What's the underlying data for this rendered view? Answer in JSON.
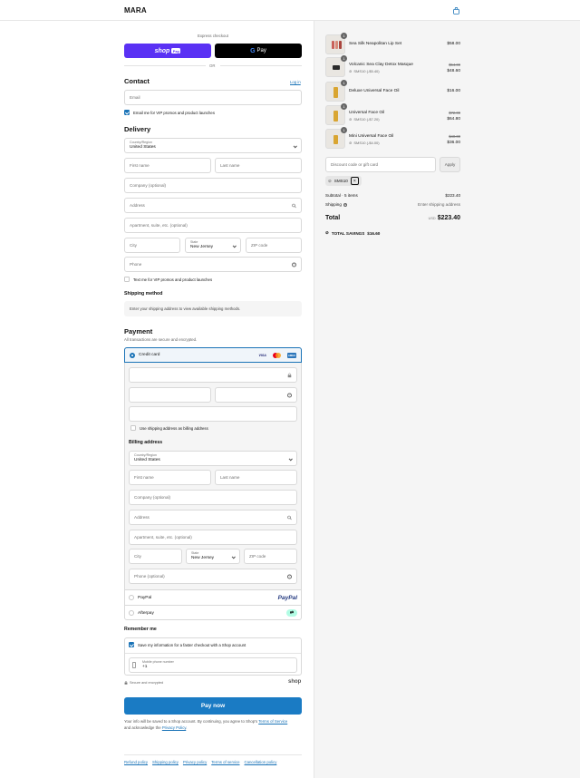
{
  "header": {
    "brand": "MARA"
  },
  "express": {
    "title": "Express checkout",
    "shop_pay": "shop",
    "shop_pay_badge": "Pay",
    "gpay": "Pay",
    "or": "OR"
  },
  "contact": {
    "title": "Contact",
    "login": "Log in",
    "email_placeholder": "Email",
    "vip_email": "Email me for VIP promos and product launches"
  },
  "delivery": {
    "title": "Delivery",
    "country_label": "Country/Region",
    "country_value": "United States",
    "first_name": "First name",
    "last_name": "Last name",
    "company": "Company (optional)",
    "address": "Address",
    "apartment": "Apartment, suite, etc. (optional)",
    "city": "City",
    "state_label": "State",
    "state_value": "New Jersey",
    "zip": "ZIP code",
    "phone": "Phone",
    "vip_text": "Text me for VIP promos and product launches"
  },
  "shipping_method": {
    "title": "Shipping method",
    "message": "Enter your shipping address to view available shipping methods."
  },
  "payment": {
    "title": "Payment",
    "subtitle": "All transactions are secure and encrypted.",
    "credit_card": "Credit card",
    "visa": "VISA",
    "amex": "AMEX",
    "use_shipping": "Use shipping address as billing address",
    "billing_title": "Billing address",
    "billing_country_label": "Country/Region",
    "billing_country_value": "United States",
    "billing_first": "First name",
    "billing_last": "Last name",
    "billing_company": "Company (optional)",
    "billing_address": "Address",
    "billing_apartment": "Apartment, suite, etc. (optional)",
    "billing_city": "City",
    "billing_state_label": "State",
    "billing_state_value": "New Jersey",
    "billing_zip": "ZIP code",
    "billing_phone": "Phone (optional)",
    "paypal": "PayPal",
    "paypal_logo": "PayPal",
    "afterpay": "Afterpay"
  },
  "remember": {
    "title": "Remember me",
    "save_info": "Save my information for a faster checkout with a Shop account",
    "mobile_label": "Mobile phone number",
    "mobile_value": "+1",
    "secure": "Secure and encrypted",
    "shop_logo": "shop"
  },
  "pay_now": "Pay now",
  "consent": {
    "text1": "Your info will be saved to a Shop account. By continuing, you agree to Shop's ",
    "tos": "Terms of Service",
    "text2": "and acknowledge the ",
    "privacy": "Privacy Policy",
    "end": "."
  },
  "footer_links": [
    "Refund policy",
    "Shipping policy",
    "Privacy policy",
    "Terms of service",
    "Cancellation policy"
  ],
  "cart": {
    "items": [
      {
        "qty": "1",
        "name": "Sea Silk Neapolitan Lip Set",
        "discount": "",
        "original": "",
        "price": "$58.00"
      },
      {
        "qty": "1",
        "name": "Volcanic Sea Clay Detox Masque",
        "discount": "SMS10 (-$5.40)",
        "original": "$54.00",
        "price": "$48.60"
      },
      {
        "qty": "1",
        "name": "Deluxe Universal Face Oil",
        "discount": "",
        "original": "",
        "price": "$16.00"
      },
      {
        "qty": "1",
        "name": "Universal Face Oil",
        "discount": "SMS10 (-$7.20)",
        "original": "$72.00",
        "price": "$64.80"
      },
      {
        "qty": "1",
        "name": "Mini Universal Face Oil",
        "discount": "SMS10 (-$4.00)",
        "original": "$40.00",
        "price": "$36.00"
      }
    ],
    "discount_placeholder": "Discount code or gift card",
    "apply": "Apply",
    "applied_code": "SMS10",
    "subtotal_label": "Subtotal · 5 items",
    "subtotal_value": "$223.40",
    "shipping_label": "Shipping",
    "shipping_value": "Enter shipping address",
    "total_label": "Total",
    "currency": "USD",
    "total_value": "$223.40",
    "savings_label": "TOTAL SAVINGS",
    "savings_value": "$16.60"
  },
  "colors": {
    "accent": "#1a73b7",
    "shop_pay": "#5a31f4",
    "pay_now": "#1a7bc4"
  }
}
